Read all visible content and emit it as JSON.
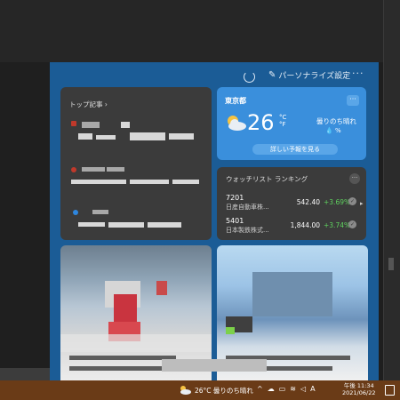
{
  "panel": {
    "personalize_label": "パーソナライズ設定",
    "more_label": "···"
  },
  "top_stories": {
    "title": "トップ記事 ›"
  },
  "weather": {
    "location": "東京都",
    "more_label": "···",
    "temperature": "26",
    "unit_c": "°C",
    "unit_f": "°F",
    "condition": "曇りのち晴れ",
    "rain": "💧 %",
    "forecast_button": "詳しい予報を見る"
  },
  "watchlist": {
    "title": "ウォッチリスト ランキング",
    "more_label": "···",
    "stocks": [
      {
        "code": "7201",
        "name": "日産自動車株...",
        "price": "542.40",
        "change": "+3.69%"
      },
      {
        "code": "5401",
        "name": "日本製鉄株式...",
        "price": "1,844.00",
        "change": "+3.74%"
      }
    ]
  },
  "taskbar": {
    "weather_text": "26°C  曇りのち晴れ",
    "time": "午後 11:34",
    "date": "2021/06/22"
  },
  "colors": {
    "panel_bg": "#1b5c96",
    "weather_card": "#3a8fdc",
    "card_dark": "#3b3b3b",
    "positive": "#5fd35f",
    "taskbar": "#6a3b17"
  }
}
